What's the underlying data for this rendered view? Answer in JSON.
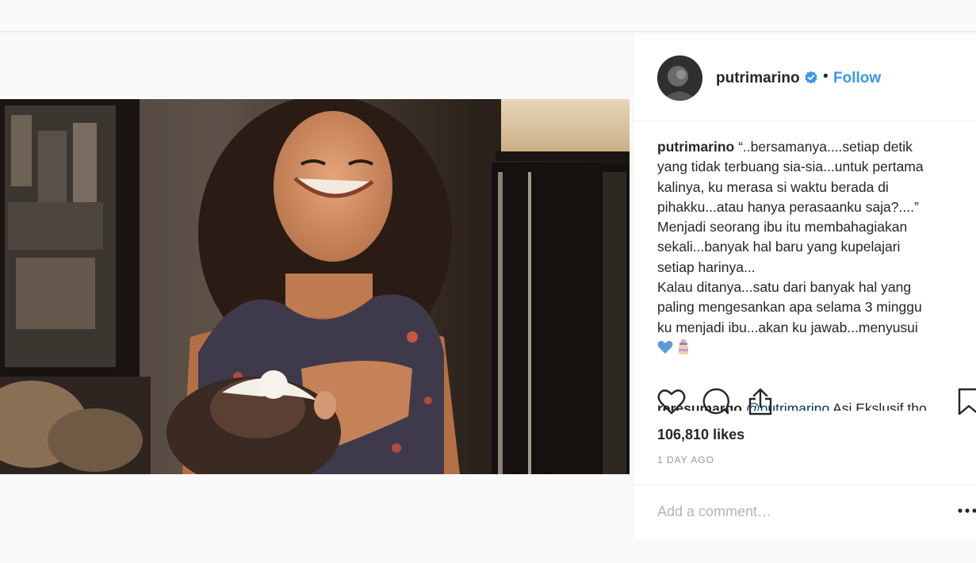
{
  "post": {
    "username": "putrimarino",
    "follow_label": "Follow",
    "dot": "•",
    "caption_lines": [
      "“..bersamanya....setiap detik",
      "yang tidak terbuang sia-sia...untuk pertama",
      "kalinya, ku merasa si waktu berada di",
      "pihakku...atau hanya perasaanku saja?....”",
      "Menjadi seorang ibu itu membahagiakan",
      "sekali...banyak hal baru yang kupelajari",
      "setiap harinya...",
      "Kalau ditanya...satu dari banyak hal yang",
      "paling mengesankan apa selama 3 minggu",
      "ku menjadi ibu...akan ku jawab...menyusui"
    ],
    "caption_emojis": [
      "blue-heart",
      "baby-bottle"
    ],
    "second_comment": {
      "username": "reresumargo",
      "mention": "@putrimarino",
      "text": " Asi Ekslusif tho"
    },
    "likes": "106,810 likes",
    "time": "1 DAY AGO",
    "comment_placeholder": "Add a comment…",
    "more_label": "•••"
  },
  "icons": {
    "like": "heart-icon",
    "comment": "comment-bubble-icon",
    "share": "share-icon",
    "save": "bookmark-icon",
    "verified": "verified-badge-icon"
  },
  "colors": {
    "link_blue": "#3897f0",
    "text": "#262626",
    "muted": "#999999",
    "mention": "#003569"
  }
}
